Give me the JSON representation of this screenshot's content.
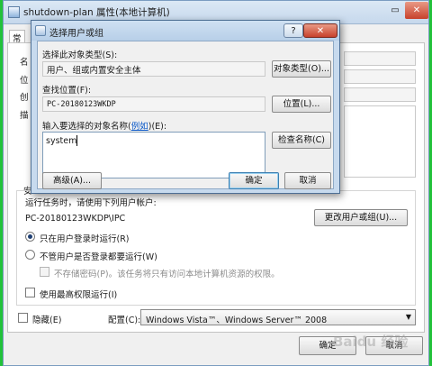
{
  "outer_window": {
    "title": "shutdown-plan 属性(本地计算机)",
    "tab_label": "常",
    "side_labels": [
      "名",
      "位",
      "创",
      "描"
    ],
    "section_label": "安",
    "run_as_prompt": "运行任务时，请使用下列用户帐户:",
    "run_as_account": "PC-20180123WKDP\\IPC",
    "change_user_button": "更改用户或组(U)...",
    "radio_logged_on": "只在用户登录时运行(R)",
    "radio_whether": "不管用户是否登录都要运行(W)",
    "checkbox_no_password": "不存储密码(P)。该任务将只有访问本地计算机资源的权限。",
    "checkbox_highest": "使用最高权限运行(I)",
    "checkbox_hidden": "隐藏(E)",
    "config_label": "配置(C):",
    "config_value": "Windows Vista™、Windows Server™ 2008",
    "ok_button": "确定",
    "cancel_button": "取消"
  },
  "dialog": {
    "title": "选择用户或组",
    "help_glyph": "?",
    "close_glyph": "✕",
    "object_type_label": "选择此对象类型(S):",
    "object_type_value": "用户、组或内置安全主体",
    "object_types_button": "对象类型(O)...",
    "location_label": "查找位置(F):",
    "location_value": "PC-20180123WKDP",
    "locations_button": "位置(L)...",
    "names_prompt_pre": "输入要选择的对象名称(",
    "names_prompt_link": "例如",
    "names_prompt_post": ")(E):",
    "names_value": "system",
    "check_names_button": "检查名称(C)",
    "advanced_button": "高级(A)...",
    "ok_button": "确定",
    "cancel_button": "取消"
  },
  "watermark": "Baidu 经验",
  "colors": {
    "frame_green": "#22c23a",
    "link_blue": "#0a58c8"
  }
}
